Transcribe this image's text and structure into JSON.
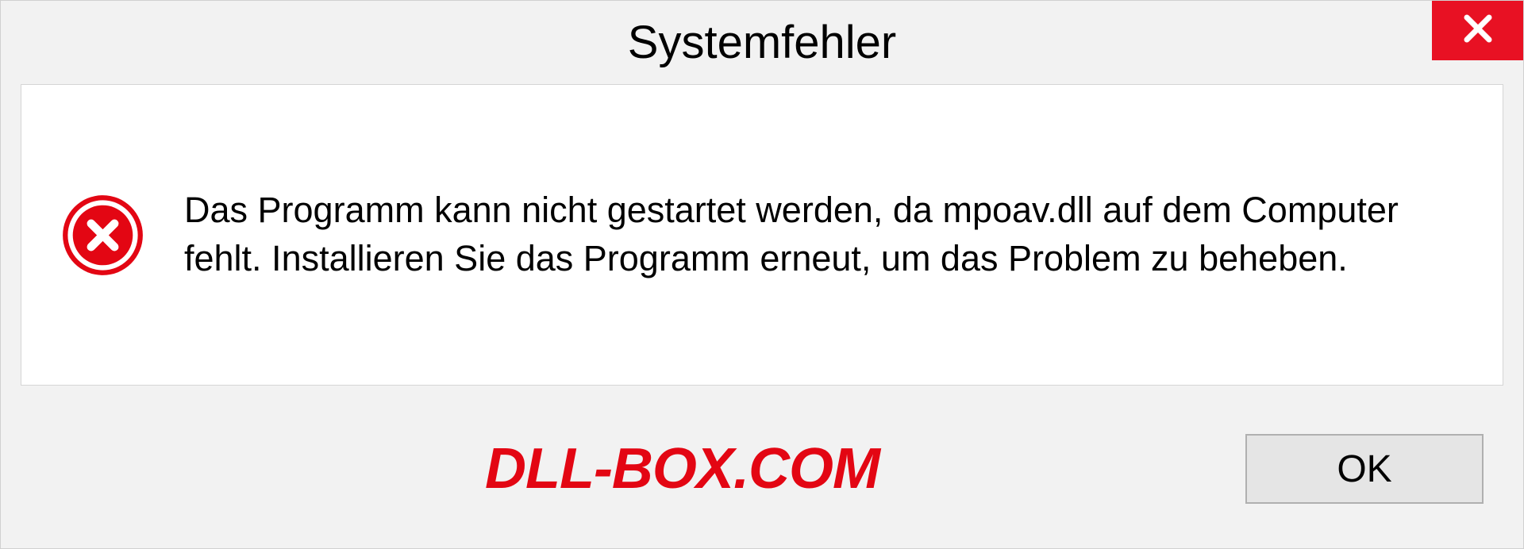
{
  "dialog": {
    "title": "Systemfehler",
    "message": "Das Programm kann nicht gestartet werden, da mpoav.dll auf dem Computer fehlt. Installieren Sie das Programm erneut, um das Problem zu beheben.",
    "ok_label": "OK"
  },
  "watermark": "DLL-BOX.COM"
}
